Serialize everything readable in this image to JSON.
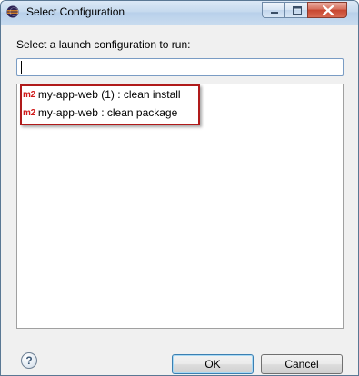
{
  "window": {
    "title": "Select Configuration"
  },
  "dialog": {
    "prompt": "Select a launch configuration to run:",
    "filter_value": "",
    "items": [
      {
        "badge": "m2",
        "label": "my-app-web (1) : clean install"
      },
      {
        "badge": "m2",
        "label": "my-app-web : clean package"
      }
    ]
  },
  "buttons": {
    "help": "?",
    "ok": "OK",
    "cancel": "Cancel"
  },
  "colors": {
    "badge": "#d11a1a",
    "highlight_border": "#b01a1a",
    "titlebar": "#c6daee",
    "close_button": "#c7452f"
  },
  "icons": {
    "app": "eclipse-icon",
    "minimize": "minimize-icon",
    "maximize": "maximize-icon",
    "close": "close-icon",
    "help": "help-icon"
  }
}
